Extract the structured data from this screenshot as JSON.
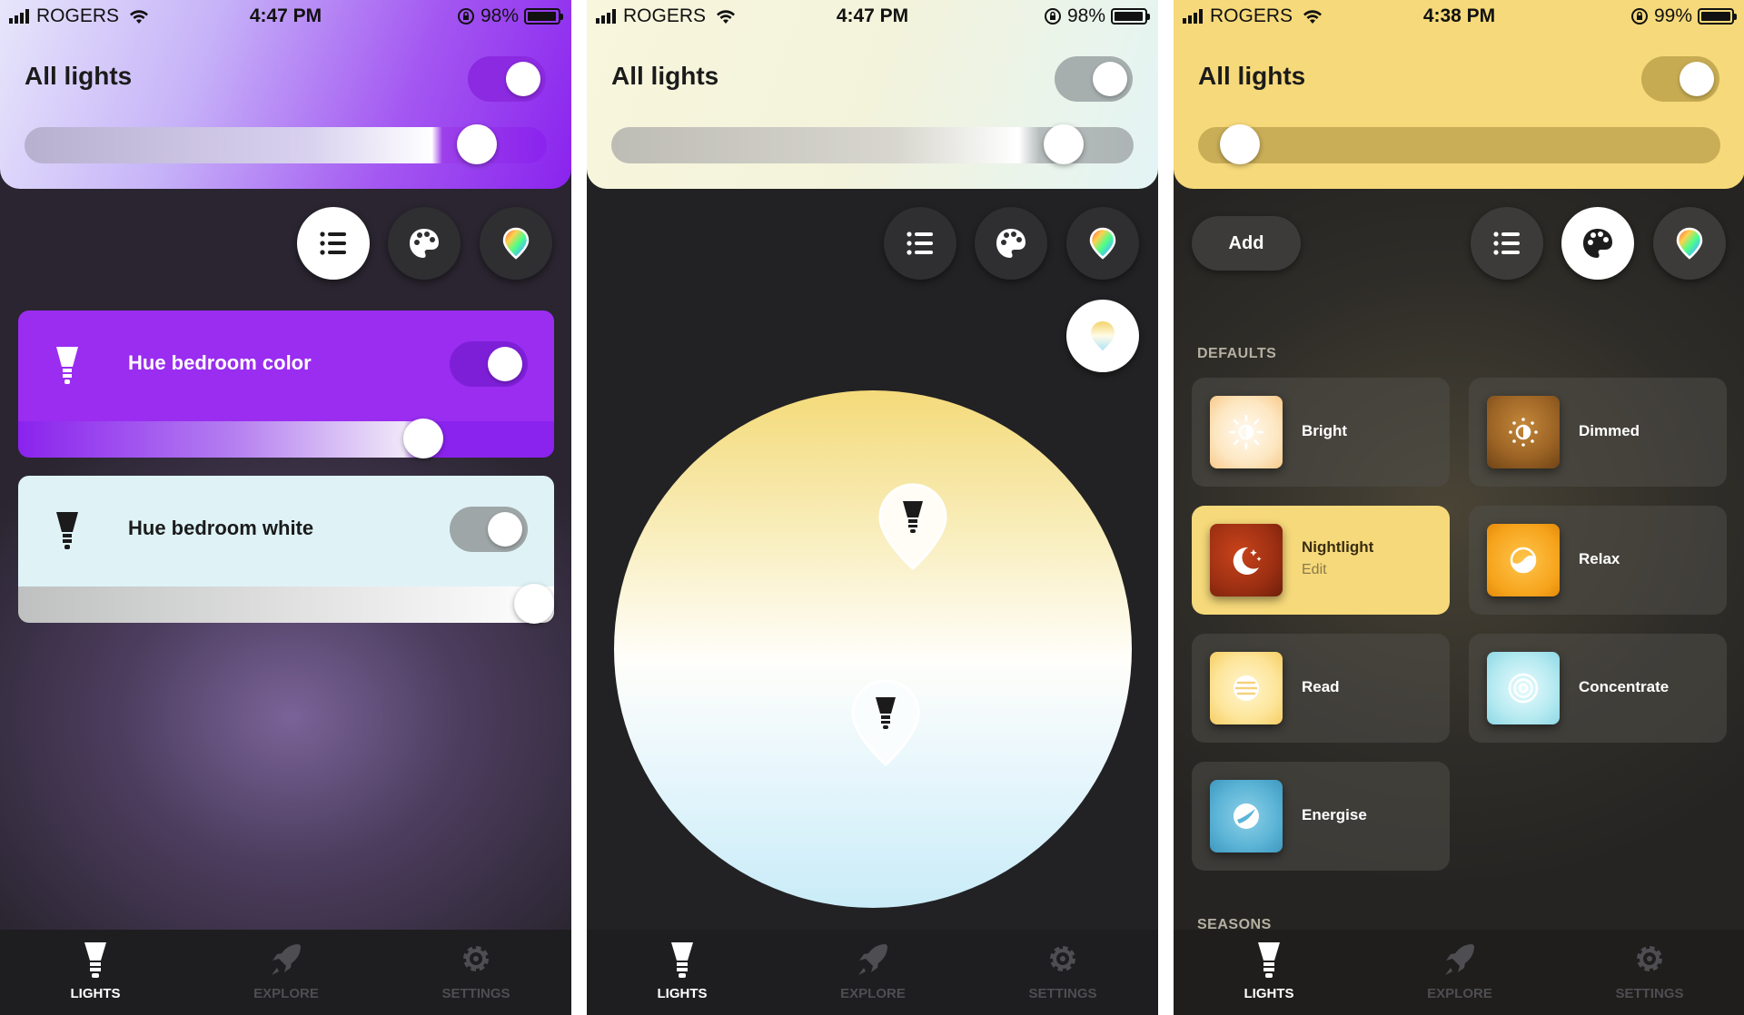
{
  "screens": [
    {
      "status": {
        "carrier": "ROGERS",
        "time": "4:47 PM",
        "battery": "98%"
      },
      "title": "All lights",
      "lights": [
        {
          "name": "Hue bedroom color"
        },
        {
          "name": "Hue bedroom white"
        }
      ],
      "tabs": [
        {
          "label": "LIGHTS"
        },
        {
          "label": "EXPLORE"
        },
        {
          "label": "SETTINGS"
        }
      ]
    },
    {
      "status": {
        "carrier": "ROGERS",
        "time": "4:47 PM",
        "battery": "98%"
      },
      "title": "All lights",
      "tabs": [
        {
          "label": "LIGHTS"
        },
        {
          "label": "EXPLORE"
        },
        {
          "label": "SETTINGS"
        }
      ]
    },
    {
      "status": {
        "carrier": "ROGERS",
        "time": "4:38 PM",
        "battery": "99%"
      },
      "title": "All lights",
      "add_label": "Add",
      "sections": {
        "defaults": "DEFAULTS",
        "seasons": "SEASONS"
      },
      "scenes": [
        {
          "name": "Bright"
        },
        {
          "name": "Dimmed"
        },
        {
          "name": "Nightlight",
          "edit": "Edit"
        },
        {
          "name": "Relax"
        },
        {
          "name": "Read"
        },
        {
          "name": "Concentrate"
        },
        {
          "name": "Energise"
        }
      ],
      "tabs": [
        {
          "label": "LIGHTS"
        },
        {
          "label": "EXPLORE"
        },
        {
          "label": "SETTINGS"
        }
      ]
    }
  ],
  "icons": [
    "signal-icon",
    "wifi-icon",
    "rotation-lock-icon",
    "battery-icon",
    "list-icon",
    "palette-icon",
    "color-picker-icon",
    "bulb-icon",
    "rocket-icon",
    "gear-icon"
  ],
  "colors": {
    "accent_purple": "#9a2df0",
    "accent_yellow": "#f6d97a",
    "pale_blue": "#dff3f7",
    "dark_bg": "#222224"
  },
  "levels": {
    "screen1_all_lights_brightness": 0.86,
    "screen1_color_light_brightness": 0.75,
    "screen1_white_light_brightness": 1.0,
    "screen2_all_lights_brightness": 0.86,
    "screen3_all_lights_brightness": 0.05
  },
  "toggles": {
    "screen1_all": true,
    "screen1_color": true,
    "screen1_white": true,
    "screen2_all": true,
    "screen3_all": true
  }
}
